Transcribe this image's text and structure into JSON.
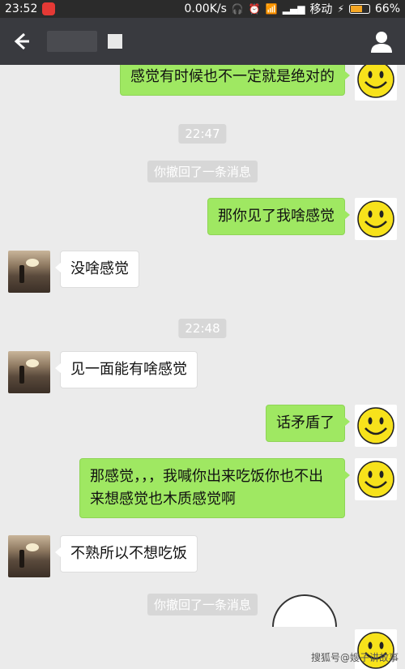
{
  "status_bar": {
    "time": "23:52",
    "speed": "0.00K/s",
    "carrier": "移动",
    "battery": "66%",
    "battery_level": 0.66
  },
  "header": {
    "back_icon": "back-arrow-icon",
    "profile_icon": "person-icon"
  },
  "messages": [
    {
      "side": "out",
      "text": "感觉有时候也不一定就是绝对的"
    },
    {
      "side": "time",
      "text": "22:47"
    },
    {
      "side": "system",
      "text": "你撤回了一条消息"
    },
    {
      "side": "out",
      "text": "那你见了我啥感觉"
    },
    {
      "side": "in",
      "text": "没啥感觉"
    },
    {
      "side": "time",
      "text": "22:48"
    },
    {
      "side": "in",
      "text": "见一面能有啥感觉"
    },
    {
      "side": "out",
      "text": "话矛盾了"
    },
    {
      "side": "out",
      "text": "那感觉，，，我喊你出来吃饭你也不出来想感觉也木质感觉啊"
    },
    {
      "side": "in",
      "text": "不熟所以不想吃饭"
    },
    {
      "side": "system",
      "text": "你撤回了一条消息"
    }
  ],
  "watermark": "搜狐号@嫂子讲故事",
  "colors": {
    "outgoing_bubble": "#9fe862",
    "incoming_bubble": "#ffffff",
    "title_bar": "#393a3f",
    "background": "#ebebeb"
  }
}
